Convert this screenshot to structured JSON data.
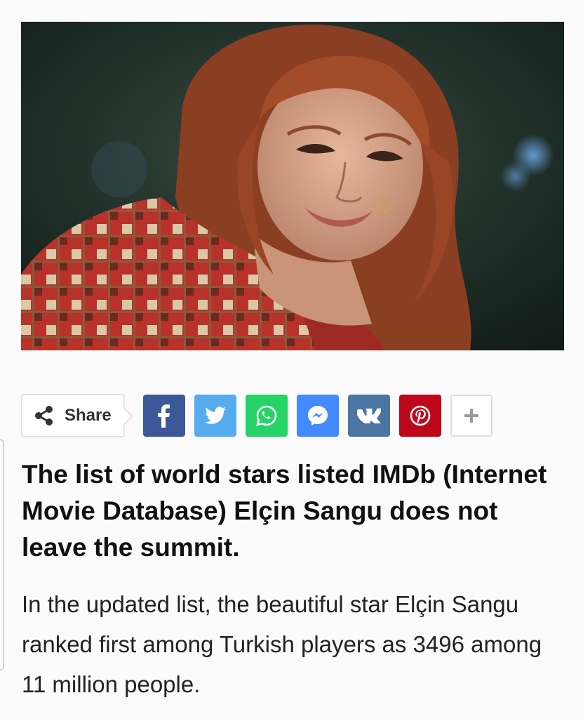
{
  "article": {
    "image_alt": "Photo of Elçin Sangu smiling",
    "share": {
      "label": "Share",
      "buttons": [
        {
          "name": "facebook",
          "icon": "facebook-icon",
          "color": "#3b5998"
        },
        {
          "name": "twitter",
          "icon": "twitter-icon",
          "color": "#55acee"
        },
        {
          "name": "whatsapp",
          "icon": "whatsapp-icon",
          "color": "#25d366"
        },
        {
          "name": "messenger",
          "icon": "messenger-icon",
          "color": "#448aff"
        },
        {
          "name": "vk",
          "icon": "vk-icon",
          "color": "#4c75a3"
        },
        {
          "name": "pinterest",
          "icon": "pinterest-icon",
          "color": "#bd081c"
        },
        {
          "name": "more",
          "icon": "plus-icon",
          "color": "#ffffff"
        }
      ]
    },
    "headline": "The list of world stars listed IMDb (Internet Movie Database) Elçin Sangu does not leave the summit.",
    "body": "In the updated list, the beautiful star Elçin Sangu ranked first among Turkish players as 3496 among 11 million people."
  }
}
